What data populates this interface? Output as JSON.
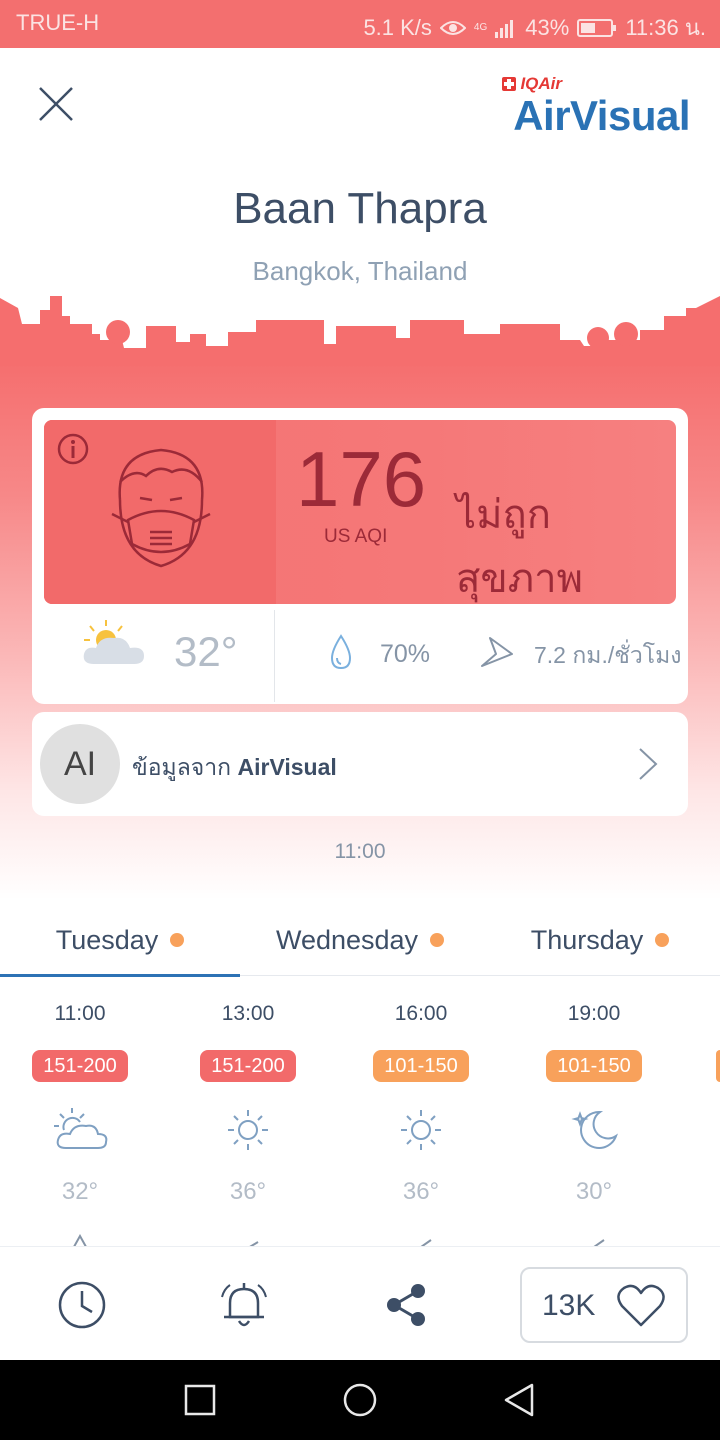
{
  "status_bar": {
    "carrier": "TRUE-H",
    "speed": "5.1 K/s",
    "network": "4G",
    "battery": "43%",
    "time": "11:36 น."
  },
  "header": {
    "brand_small": "IQAir",
    "brand_main": "AirVisual",
    "city": "Baan Thapra",
    "region": "Bangkok, Thailand"
  },
  "aqi": {
    "value": "176",
    "unit": "US AQI",
    "status": "ไม่ถูกสุขภาพ",
    "color": "#f26a6a",
    "text_color": "#9c2a38"
  },
  "weather": {
    "icon": "partly-cloudy-icon",
    "temperature": "32°",
    "humidity": "70%",
    "wind_speed": "7.2 กม./ชั่วโมง"
  },
  "source": {
    "avatar_text": "AI",
    "prefix": "ข้อมูลจาก",
    "name": "AirVisual"
  },
  "updated_time": "11:00",
  "tabs": [
    {
      "label": "Tuesday",
      "dot_color": "#f8a15b",
      "active": true
    },
    {
      "label": "Wednesday",
      "dot_color": "#f8a15b",
      "active": false
    },
    {
      "label": "Thursday",
      "dot_color": "#f8a15b",
      "active": false
    }
  ],
  "forecast": [
    {
      "time": "11:00",
      "aqi_range": "151-200",
      "badge_color": "#f26a6a",
      "icon": "partly-cloudy-icon",
      "temp": "32°"
    },
    {
      "time": "13:00",
      "aqi_range": "151-200",
      "badge_color": "#f26a6a",
      "icon": "sun-icon",
      "temp": "36°"
    },
    {
      "time": "16:00",
      "aqi_range": "101-150",
      "badge_color": "#f8a15b",
      "icon": "sun-icon",
      "temp": "36°"
    },
    {
      "time": "19:00",
      "aqi_range": "101-150",
      "badge_color": "#f8a15b",
      "icon": "moon-icon",
      "temp": "30°"
    }
  ],
  "toolbar": {
    "like_count": "13K"
  },
  "colors": {
    "accent": "#2d72b5",
    "header_red": "#f36f6f",
    "unhealthy": "#f26a6a",
    "sensitive": "#f8a15b",
    "text_dark": "#3d4e66",
    "text_muted": "#8594a6"
  }
}
